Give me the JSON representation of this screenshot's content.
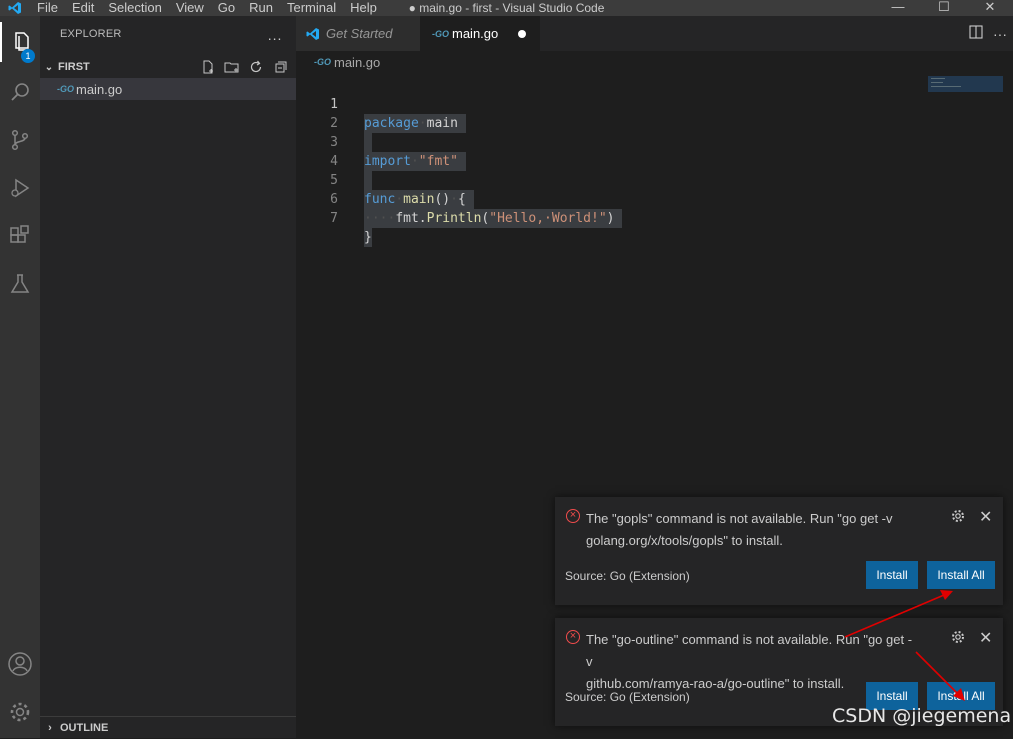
{
  "window": {
    "title": "● main.go - first - Visual Studio Code",
    "menu": [
      "File",
      "Edit",
      "Selection",
      "View",
      "Go",
      "Run",
      "Terminal",
      "Help"
    ]
  },
  "activity": {
    "badge": "1",
    "icons": [
      "explorer-icon",
      "search-icon",
      "source-control-icon",
      "run-debug-icon",
      "extensions-icon",
      "testing-icon",
      "account-icon",
      "manage-gear-icon"
    ]
  },
  "sidebar": {
    "header": "EXPLORER",
    "more": "···",
    "folder": "FIRST",
    "files": [
      {
        "icon": "-GO",
        "name": "main.go"
      }
    ],
    "outline": "OUTLINE"
  },
  "tabs": [
    {
      "label": "Get Started"
    },
    {
      "icon": "-GO",
      "label": "main.go"
    }
  ],
  "breadcrumb": {
    "icon": "-GO",
    "label": "main.go"
  },
  "editor": {
    "line_numbers": [
      "1",
      "2",
      "3",
      "4",
      "5",
      "6",
      "7"
    ]
  },
  "notifications": [
    {
      "message_line1": "The \"gopls\" command is not available. Run \"go get -v",
      "message_line2": "golang.org/x/tools/gopls\" to install.",
      "source": "Source: Go (Extension)",
      "install": "Install",
      "install_all": "Install All"
    },
    {
      "message_line1": "The \"go-outline\" command is not available. Run \"go get -v",
      "message_line2": "github.com/ramya-rao-a/go-outline\" to install.",
      "source": "Source: Go (Extension)",
      "install": "Install",
      "install_all": "Install All"
    }
  ],
  "watermark": "CSDN @jiegemena",
  "colors": {
    "accent": "#007acc",
    "button": "#0e639c",
    "error": "#f14c4c",
    "annotation": "#e00000"
  }
}
